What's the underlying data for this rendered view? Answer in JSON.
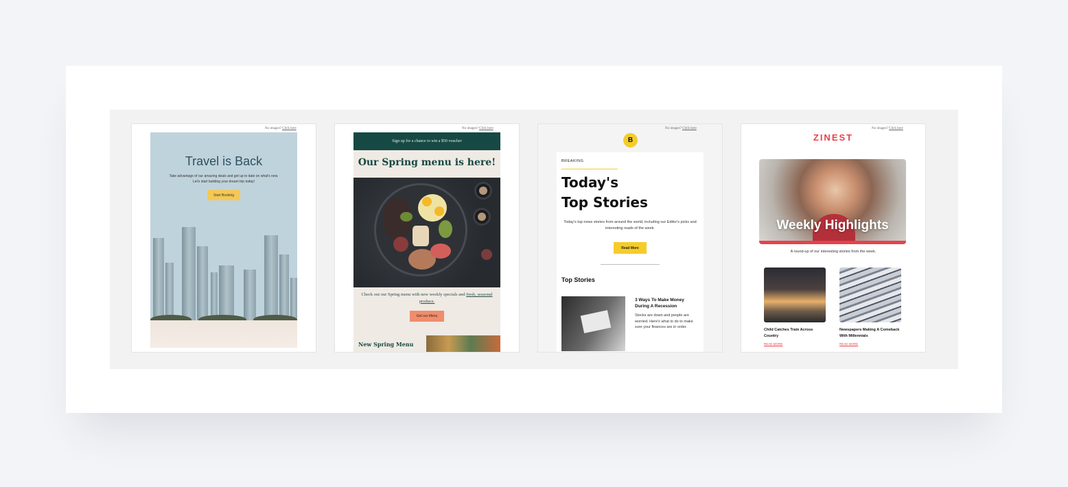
{
  "templates": [
    {
      "no_images_text": "No images?",
      "no_images_link": "Click here",
      "title": "Travel is Back",
      "description_line1": "Take advantage of our amazing deals and get up to date on what's new.",
      "description_line2": "Let's start building your dream trip today!",
      "button": "Start Booking"
    },
    {
      "no_images_text": "No images?",
      "no_images_link": "Click here",
      "banner": "Sign up for a chance to win a $50 voucher",
      "title": "Our Spring menu is here!",
      "copy": "Check out our Spring menu with new weekly specials and",
      "copy_link": "fresh, seasonal produce.",
      "button": "Get our Menu",
      "subheading": "New Spring Menu"
    },
    {
      "no_images_text": "No images?",
      "no_images_link": "Click here",
      "logo_letter": "B",
      "kicker": "BREAKING",
      "title_line1": "Today's",
      "title_line2": "Top Stories",
      "intro": "Today's top news stories from around the world, including our Editor's picks and interesting reads of the week.",
      "button": "Read More",
      "section": "Top Stories",
      "story_title": "3 Ways To Make Money During A Recession",
      "story_desc": "Stocks are down and people are worried. Here's what to do to make sure your finances are in order."
    },
    {
      "no_images_text": "No images?",
      "no_images_link": "Click here",
      "brand": "ZINEST",
      "hero_title": "Weekly Highlights",
      "tagline": "A round-up of our interesting stories from the week.",
      "story_a": "Child Catches Train Across Country",
      "story_b": "Newspapers Making A Comeback With Millennials",
      "read_more": "READ MORE"
    }
  ]
}
